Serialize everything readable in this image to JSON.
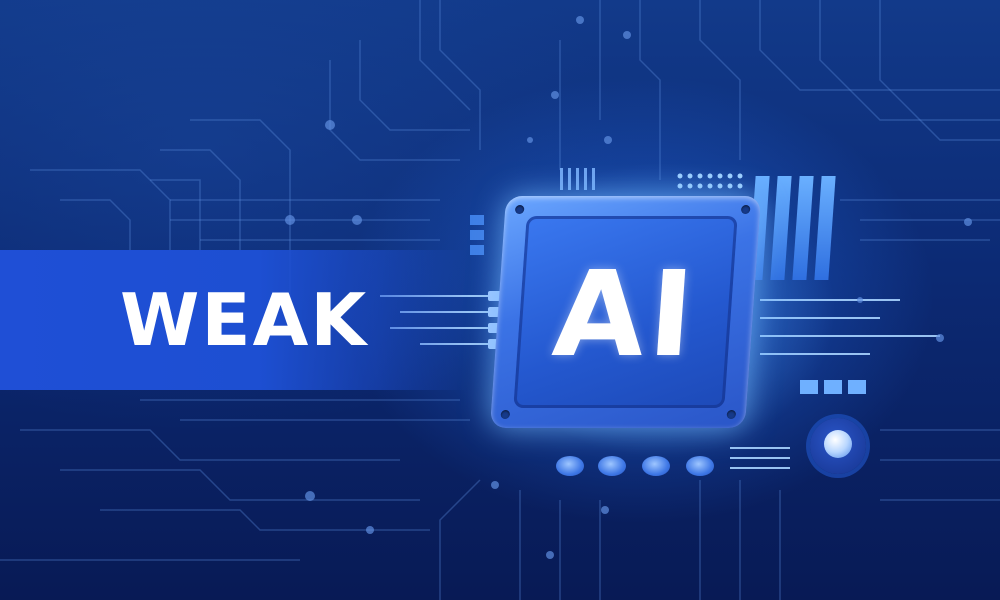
{
  "banner": {
    "title": "WEAK"
  },
  "chip": {
    "label": "AI"
  },
  "colors": {
    "background": "#0c2a74",
    "banner": "#1f4fd6",
    "chip": "#2a56c8",
    "text": "#ffffff",
    "circuit_line": "#4f7fd0"
  }
}
